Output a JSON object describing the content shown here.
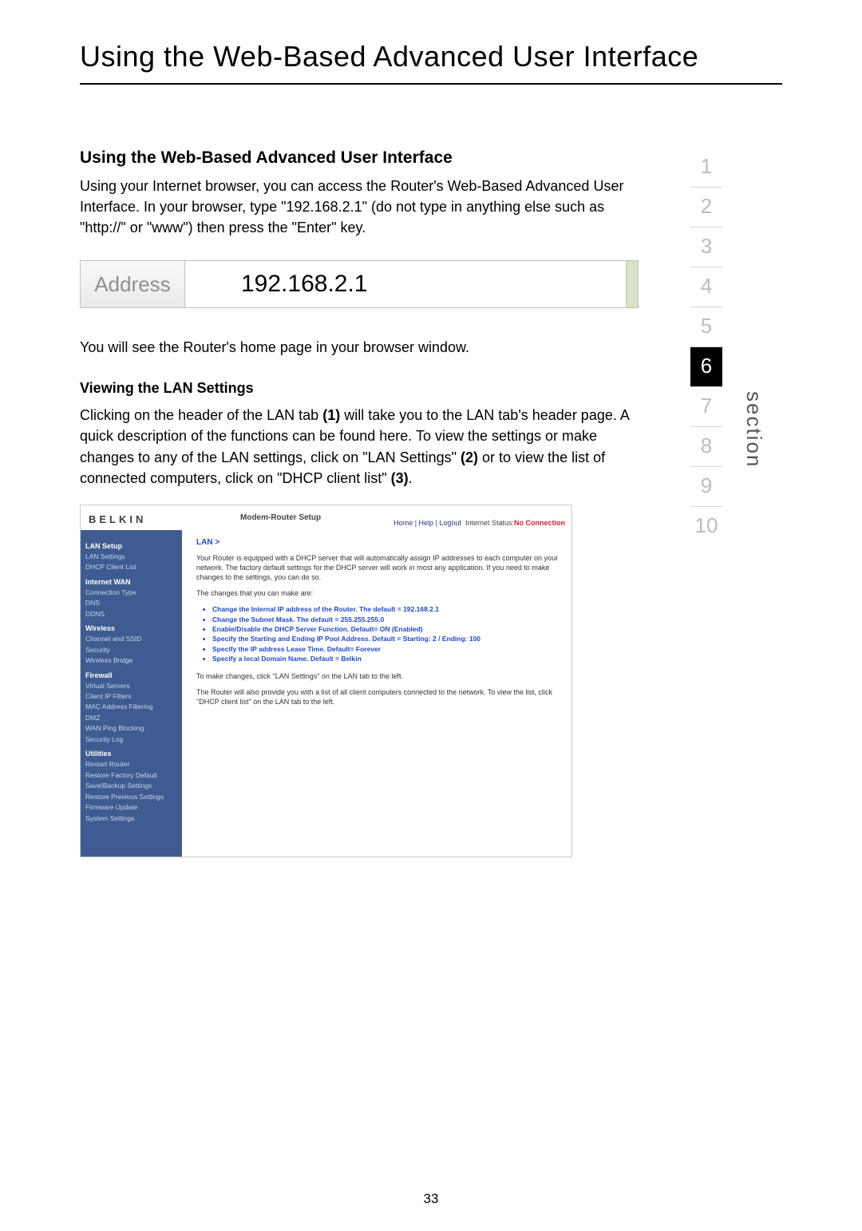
{
  "title": "Using the Web-Based Advanced User Interface",
  "section_heading": "Using the Web-Based Advanced User Interface",
  "intro": "Using your Internet browser, you can access the Router's Web-Based Advanced User Interface. In your browser, type \"192.168.2.1\" (do not type in anything else such as \"http://\" or \"www\") then press the \"Enter\" key.",
  "address_bar": {
    "label": "Address",
    "value": "192.168.2.1"
  },
  "after_addr": "You will see the Router's home page in your browser window.",
  "lan_heading": "Viewing the LAN Settings",
  "lan_para": {
    "a": "Clicking on the header of the LAN tab ",
    "b1": "(1)",
    "b": " will take you to the LAN tab's header page. A quick description of the functions can be found here. To view the settings or make changes to any of the LAN settings, click on \"LAN Settings\" ",
    "b2": "(2)",
    "c": " or to view the list of connected computers, click on \"DHCP client list\" ",
    "b3": "(3)",
    "d": "."
  },
  "section_nav": {
    "items": [
      "1",
      "2",
      "3",
      "4",
      "5",
      "6",
      "7",
      "8",
      "9",
      "10"
    ],
    "active_index": 5,
    "label": "section"
  },
  "router": {
    "brand": "BELKIN",
    "modem_title": "Modem-Router Setup",
    "header_links": [
      "Home",
      "Help",
      "Logout"
    ],
    "status_label": "Internet Status:",
    "status_value": "No Connection",
    "sidebar": [
      {
        "h": "LAN Setup",
        "items": [
          "LAN Settings",
          "DHCP Client List"
        ]
      },
      {
        "h": "Internet WAN",
        "items": [
          "Connection Type",
          "DNS",
          "DDNS"
        ]
      },
      {
        "h": "Wireless",
        "items": [
          "Channel and SSID",
          "Security",
          "Wireless Bridge"
        ]
      },
      {
        "h": "Firewall",
        "items": [
          "Virtual Servers",
          "Client IP Filters",
          "MAC Address Filtering",
          "DMZ",
          "WAN Ping Blocking",
          "Security Log"
        ]
      },
      {
        "h": "Utilities",
        "items": [
          "Restart Router",
          "Restore Factory Default",
          "Save/Backup Settings",
          "Restore Previous Settings",
          "Firmware Update",
          "System Settings"
        ]
      }
    ],
    "panel": {
      "crumb": "LAN >",
      "p1": "Your Router is equipped with a DHCP server that will automatically assign IP addresses to each computer on your network. The factory default settings for the DHCP server will work in most any application. If you need to make changes to the settings, you can do so.",
      "p2": "The changes that you can make are:",
      "bullets": [
        "Change the Internal IP address of the Router. The default = 192.168.2.1",
        "Change the Subnet Mask. The default = 255.255.255.0",
        "Enable/Disable the DHCP Server Function. Default= ON (Enabled)",
        "Specify the Starting and Ending IP Pool Address. Default = Starting: 2 / Ending: 100",
        "Specify the IP address Lease Time. Default= Forever",
        "Specify a local Domain Name. Default = Belkin"
      ],
      "p3": "To make changes, click \"LAN Settings\" on the LAN tab to the left.",
      "p4": "The Router will also provide you with a list of all client computers connected to the network. To view the list, click \"DHCP client list\" on the LAN tab to the left."
    }
  },
  "page_number": "33"
}
